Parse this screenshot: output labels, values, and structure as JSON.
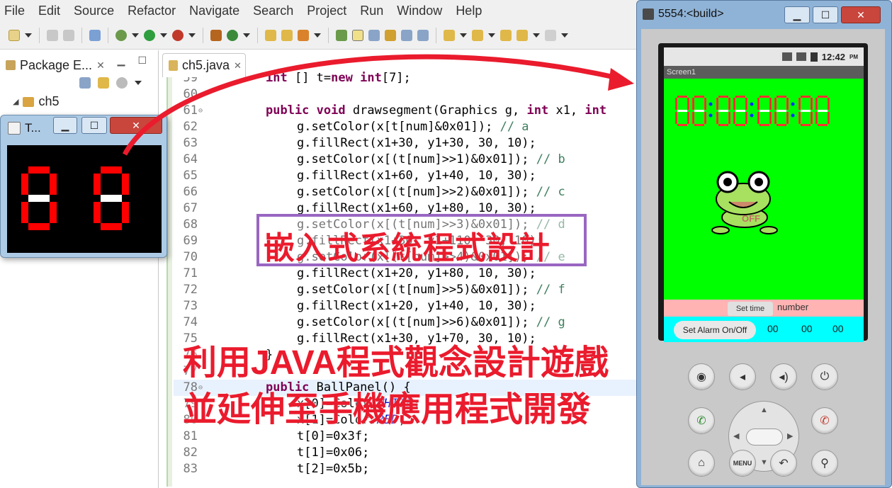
{
  "menubar": {
    "items": [
      "File",
      "Edit",
      "Source",
      "Refactor",
      "Navigate",
      "Search",
      "Project",
      "Run",
      "Window",
      "Help"
    ]
  },
  "package_explorer": {
    "tab_label": "Package E...",
    "project": "ch5"
  },
  "editor": {
    "tab_label": "ch5.java",
    "lines": [
      {
        "n": "59",
        "code": "int [] t=new int[7];"
      },
      {
        "n": "60",
        "code": ""
      },
      {
        "n": "61",
        "code": "public void drawsegment(Graphics g, int x1, int"
      },
      {
        "n": "62",
        "code": "g.setColor(x[t[num]&0x01]); // a"
      },
      {
        "n": "63",
        "code": "g.fillRect(x1+30, y1+30, 30, 10);"
      },
      {
        "n": "64",
        "code": "g.setColor(x[(t[num]>>1)&0x01]); // b"
      },
      {
        "n": "65",
        "code": "g.fillRect(x1+60, y1+40, 10, 30);"
      },
      {
        "n": "66",
        "code": "g.setColor(x[(t[num]>>2)&0x01]); // c"
      },
      {
        "n": "67",
        "code": "g.fillRect(x1+60, y1+80, 10, 30);"
      },
      {
        "n": "68",
        "code": "g.setColor(x[(t[num]>>3)&0x01]); // d"
      },
      {
        "n": "69",
        "code": "g.fillRect(x1+30, y1+110, 30, 10);"
      },
      {
        "n": "70",
        "code": "g.setColor(x[(t[num]>>4)&0x01]); // e"
      },
      {
        "n": "71",
        "code": "g.fillRect(x1+20, y1+80, 10, 30);"
      },
      {
        "n": "72",
        "code": "g.setColor(x[(t[num]>>5)&0x01]); // f"
      },
      {
        "n": "73",
        "code": "g.fillRect(x1+20, y1+40, 10, 30);"
      },
      {
        "n": "74",
        "code": "g.setColor(x[(t[num]>>6)&0x01]); // g"
      },
      {
        "n": "75",
        "code": "g.fillRect(x1+30, y1+70, 30, 10);"
      },
      {
        "n": "76",
        "code": "}"
      },
      {
        "n": "77",
        "code": ""
      },
      {
        "n": "78",
        "code": "public BallPanel() {"
      },
      {
        "n": "79",
        "code": "x[0]=Color.WHITE;"
      },
      {
        "n": "80",
        "code": "x[1]=Color.RED;"
      },
      {
        "n": "81",
        "code": "t[0]=0x3f;"
      },
      {
        "n": "82",
        "code": "t[1]=0x06;"
      },
      {
        "n": "83",
        "code": "t[2]=0x5b;"
      }
    ]
  },
  "java_frame": {
    "title": "T..."
  },
  "emulator": {
    "title": "5554:<build>",
    "clock": "12:42",
    "app_title": "Screen1",
    "frog_label": "OFF",
    "set_time_label": "Set time",
    "number_label": "number",
    "alarm_button_label": "Set Alarm On/Off",
    "alarm_values": [
      "00",
      "00",
      "00"
    ]
  },
  "overlay": {
    "title": "嵌入式系統程式設計",
    "caption_line1": "利用JAVA程式觀念設計遊戲",
    "caption_line2": "並延伸至手機應用程式開發"
  },
  "colors": {
    "accent_red": "#ea1b2d",
    "box_purple": "#9966c2",
    "keyword": "#7f0055",
    "comment": "#3f7f5f",
    "field": "#0000c0",
    "segment_on": "#ff0000",
    "segment_off": "#ffffff",
    "app_green": "#00ff00",
    "alarm_cyan": "#00ffff",
    "settime_pink": "#ffb3b3"
  }
}
